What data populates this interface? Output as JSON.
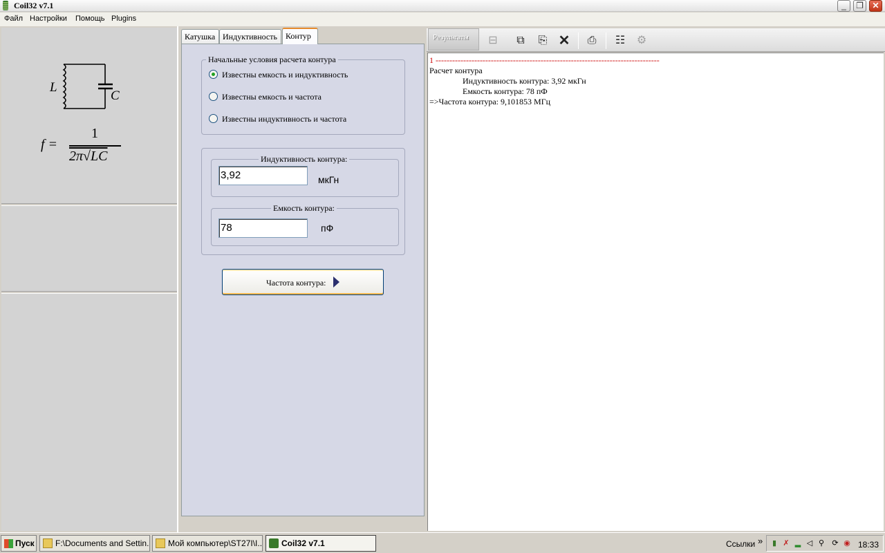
{
  "window": {
    "title": "Coil32 v7.1",
    "minimize_glyph": "_",
    "restore_glyph": "❐",
    "close_glyph": "✕"
  },
  "menu": [
    "Файл",
    "Настройки",
    "Помощь",
    "Plugins"
  ],
  "formula_panel": {
    "inductor_label": "L",
    "capacitor_label": "C",
    "formula_lhs": "f =",
    "numerator": "1",
    "denominator": "2π√LC"
  },
  "tabs": [
    {
      "label": "Катушка",
      "active": false
    },
    {
      "label": "Индуктивность",
      "active": false
    },
    {
      "label": "Контур",
      "active": true
    }
  ],
  "initial_conditions": {
    "title": "Начальные условия расчета контура",
    "options": [
      {
        "label": "Известны емкость и индуктивность",
        "checked": true
      },
      {
        "label": "Известны емкость и частота",
        "checked": false
      },
      {
        "label": "Известны индуктивность и частота",
        "checked": false
      }
    ]
  },
  "inductance": {
    "title": "Индуктивность контура:",
    "value": "3,92",
    "unit": "мкГн"
  },
  "capacitance": {
    "title": "Емкость контура:",
    "value": "78",
    "unit": "пФ"
  },
  "calc_button": {
    "label": "Частота контура:"
  },
  "results": {
    "tab_label": "Результаты",
    "toolbar_icons": [
      "tree-icon",
      "copy-icon",
      "paste-icon",
      "clear-icon",
      "print-icon",
      "list-icon",
      "gear-icon"
    ],
    "lines": [
      {
        "text": "1 ---------------------------------------------------------------------------------",
        "color": "#cc0000",
        "indent": false
      },
      {
        "text": "Расчет контура",
        "color": "#000000",
        "indent": false
      },
      {
        "text": "Индуктивность контура: 3,92 мкГн",
        "color": "#000000",
        "indent": true
      },
      {
        "text": "Емкость контура: 78 пФ",
        "color": "#000000",
        "indent": true
      },
      {
        "text": "=>Частота контура: 9,101853 МГц",
        "color": "#000000",
        "indent": false
      }
    ]
  },
  "taskbar": {
    "start_label": "Пуск",
    "tasks": [
      {
        "label": "F:\\Documents and Settin...",
        "active": false
      },
      {
        "label": "Мой компьютер\\ST27I\\I...",
        "active": false
      },
      {
        "label": "Coil32 v7.1",
        "active": true
      }
    ],
    "links_label": "Ссылки",
    "chevron": "»",
    "clock": "18:33"
  }
}
